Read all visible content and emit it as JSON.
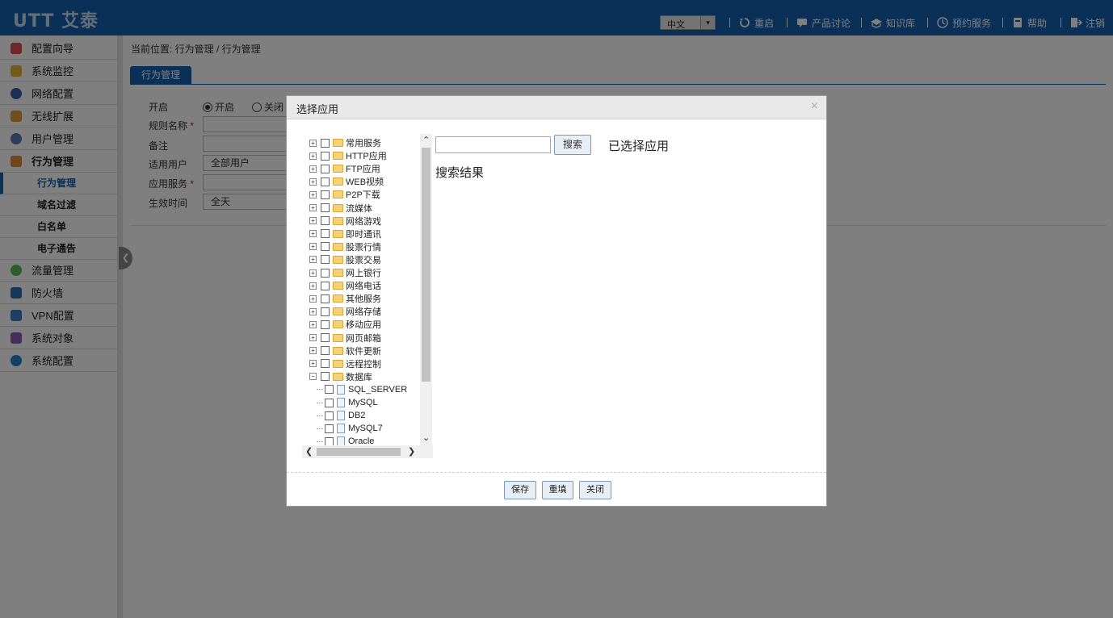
{
  "header": {
    "logo": "UTT 艾泰",
    "language": "中文",
    "nav": [
      {
        "label": "重启",
        "icon": "restart-icon"
      },
      {
        "label": "产品讨论",
        "icon": "discussion-icon"
      },
      {
        "label": "知识库",
        "icon": "knowledge-icon"
      },
      {
        "label": "预约服务",
        "icon": "appointment-icon"
      },
      {
        "label": "帮助",
        "icon": "help-icon"
      },
      {
        "label": "注销",
        "icon": "logout-icon"
      }
    ]
  },
  "sidebar": {
    "items": [
      {
        "label": "配置向导",
        "icon": "pin-icon",
        "color": "#d9534f"
      },
      {
        "label": "系统监控",
        "icon": "monitor-icon",
        "color": "#e6b53a"
      },
      {
        "label": "网络配置",
        "icon": "globe-icon",
        "color": "#3a5fa8"
      },
      {
        "label": "无线扩展",
        "icon": "wireless-icon",
        "color": "#e09a3a"
      },
      {
        "label": "用户管理",
        "icon": "users-icon",
        "color": "#5a7fb0"
      },
      {
        "label": "行为管理",
        "icon": "hand-icon",
        "color": "#e0883a"
      },
      {
        "label": "流量管理",
        "icon": "traffic-icon",
        "color": "#5cb85c"
      },
      {
        "label": "防火墙",
        "icon": "shield-icon",
        "color": "#2a6fb8"
      },
      {
        "label": "VPN配置",
        "icon": "vpn-icon",
        "color": "#3a7fc8"
      },
      {
        "label": "系统对象",
        "icon": "cube-icon",
        "color": "#8a5ab8"
      },
      {
        "label": "系统配置",
        "icon": "gear-icon",
        "color": "#2a7fc8"
      }
    ],
    "subitems": [
      "行为管理",
      "域名过滤",
      "白名单",
      "电子通告"
    ]
  },
  "main": {
    "breadcrumb": "当前位置: 行为管理 / 行为管理",
    "tab": "行为管理",
    "form": {
      "enable_label": "开启",
      "on_label": "开启",
      "off_label": "关闭",
      "rule_name_label": "规则名称",
      "remark_label": "备注",
      "users_label": "适用用户",
      "users_value": "全部用户",
      "service_label": "应用服务",
      "time_label": "生效时间",
      "time_value": "全天",
      "required_mark": "*"
    }
  },
  "modal": {
    "title": "选择应用",
    "close": "×",
    "search_button": "搜索",
    "selected_title": "已选择应用",
    "results_title": "搜索结果",
    "tree_groups": [
      "常用服务",
      "HTTP应用",
      "FTP应用",
      "WEB视频",
      "P2P下载",
      "流媒体",
      "网络游戏",
      "即时通讯",
      "股票行情",
      "股票交易",
      "网上银行",
      "网络电话",
      "其他服务",
      "网络存储",
      "移动应用",
      "网页邮箱",
      "软件更新",
      "远程控制"
    ],
    "open_group": "数据库",
    "open_group_children": [
      "SQL_SERVER",
      "MySQL",
      "DB2",
      "MySQL7",
      "Oracle"
    ],
    "buttons": {
      "save": "保存",
      "reset": "重填",
      "close": "关闭"
    }
  }
}
